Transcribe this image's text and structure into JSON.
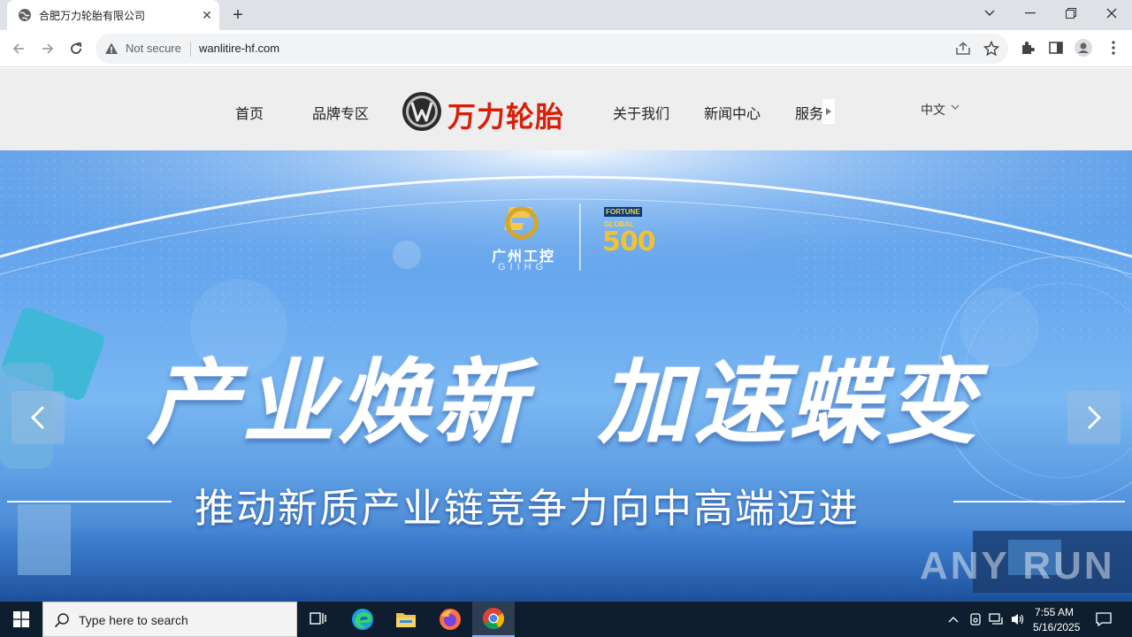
{
  "browser": {
    "tab_title": "合肥万力轮胎有限公司",
    "not_secure_label": "Not secure",
    "url": "wanlitire-hf.com"
  },
  "site": {
    "nav": {
      "home": "首页",
      "brands": "品牌专区",
      "logo_text": "万力轮胎",
      "about": "关于我们",
      "news": "新闻中心",
      "services": "服务"
    },
    "language": "中文"
  },
  "hero": {
    "group_name_cn": "广州工控",
    "group_name_en": "GIIHG",
    "fortune_label": "FORTUNE",
    "global_label": "GLOBAL",
    "fortune_number": "500",
    "headline_left": "产业焕新",
    "headline_right": "加速蝶变",
    "subline": "推动新质产业链竞争力向中高端迈进",
    "watermark": "ANY RUN"
  },
  "taskbar": {
    "search_placeholder": "Type here to search",
    "time": "7:55 AM",
    "date": "5/16/2025"
  },
  "colors": {
    "brand_red": "#d81e06",
    "taskbar_bg": "#0f1e2e",
    "hero_blue": "#6aaaf0"
  }
}
